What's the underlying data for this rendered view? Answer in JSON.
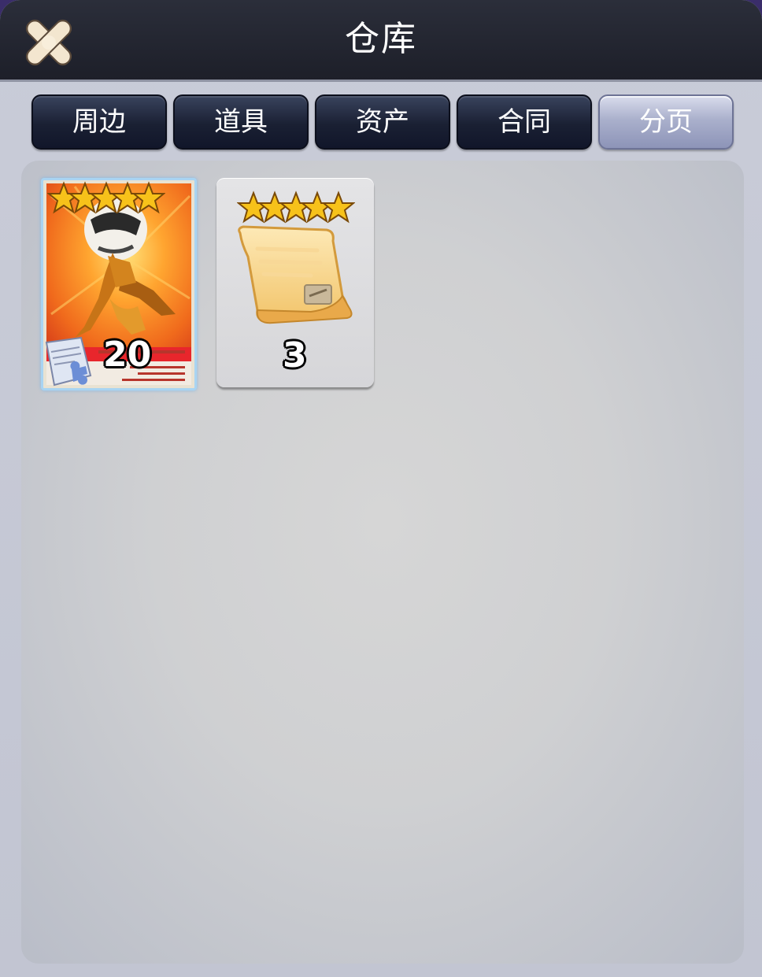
{
  "window": {
    "title": "仓库",
    "close_icon": "close-x-icon"
  },
  "tabs": [
    {
      "label": "周边",
      "active": false
    },
    {
      "label": "道具",
      "active": false
    },
    {
      "label": "资产",
      "active": false
    },
    {
      "label": "合同",
      "active": false
    },
    {
      "label": "分页",
      "active": true
    }
  ],
  "items": [
    {
      "icon": "player-card-icon",
      "stars": 5,
      "count": "20",
      "badge_icon": "puzzle-document-icon"
    },
    {
      "icon": "contract-scroll-icon",
      "stars": 5,
      "count": "3"
    }
  ],
  "colors": {
    "titlebar": "#1d1f29",
    "tab_inactive": "#1a2033",
    "tab_active": "#aab0cc",
    "panel": "#d2d3d5",
    "star": "#f7c21a"
  }
}
